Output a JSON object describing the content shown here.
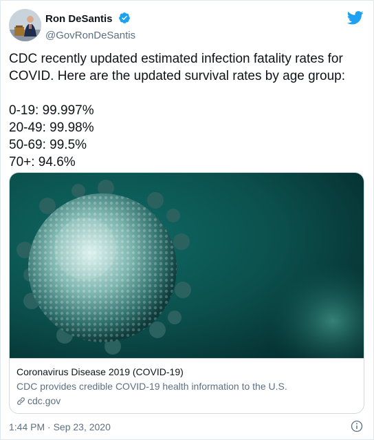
{
  "account": {
    "display_name": "Ron DeSantis",
    "handle": "@GovRonDeSantis",
    "verified": true,
    "avatar_icon": "avatar-podium-icon"
  },
  "tweet": {
    "lines": [
      "CDC recently updated estimated infection fatality rates for",
      "COVID. Here are the updated survival rates by age group:"
    ],
    "stats": [
      "0-19: 99.997%",
      "20-49: 99.98%",
      "50-69: 99.5%",
      "70+: 94.6%"
    ]
  },
  "card": {
    "title": "Coronavirus Disease 2019 (COVID-19)",
    "description": "CDC provides credible COVID-19 health information to the U.S.",
    "domain": "cdc.gov",
    "image_icon": "coronavirus-illustration"
  },
  "footer": {
    "timestamp": "1:44 PM · Sep 23, 2020",
    "info_icon": "info-icon"
  },
  "colors": {
    "twitter_blue": "#1da1f2",
    "text_primary": "#0f1419",
    "text_secondary": "#5b7083",
    "border": "#cfd9de",
    "image_teal": "#0b4f4c"
  }
}
